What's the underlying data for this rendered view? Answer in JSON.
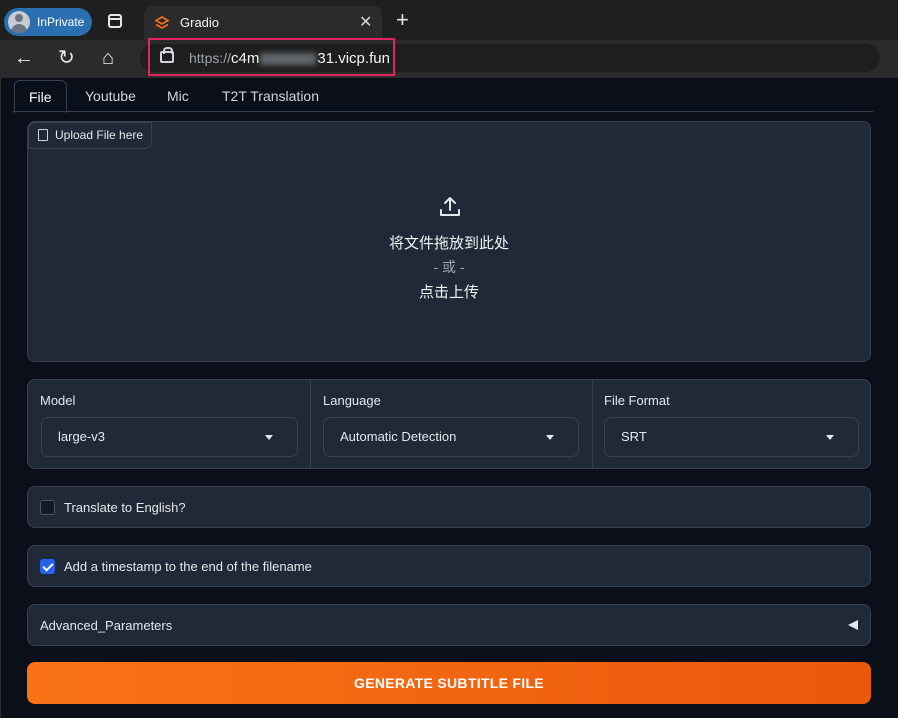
{
  "browser": {
    "profile_label": "InPrivate",
    "tab_title": "Gradio",
    "tab_close": "✕",
    "new_tab": "+",
    "url_scheme": "https://",
    "url_host_start": "c4m",
    "url_host_end": "31.vicp.fun",
    "nav": {
      "back": "←",
      "refresh": "↻",
      "home": "⌂"
    }
  },
  "tabs": [
    {
      "label": "File",
      "selected": true
    },
    {
      "label": "Youtube",
      "selected": false
    },
    {
      "label": "Mic",
      "selected": false
    },
    {
      "label": "T2T Translation",
      "selected": false
    }
  ],
  "upload": {
    "chip_label": "Upload File here",
    "drop_text": "将文件拖放到此处",
    "or_text": "- 或 -",
    "click_text": "点击上传"
  },
  "options": {
    "model": {
      "label": "Model",
      "value": "large-v3"
    },
    "language": {
      "label": "Language",
      "value": "Automatic Detection"
    },
    "file_format": {
      "label": "File Format",
      "value": "SRT"
    }
  },
  "translate_checkbox": {
    "label": "Translate to English?",
    "checked": false
  },
  "timestamp_checkbox": {
    "label": "Add a timestamp to the end of the filename",
    "checked": true
  },
  "advanced": {
    "label": "Advanced_Parameters"
  },
  "generate_button": {
    "label": "GENERATE SUBTITLE FILE"
  },
  "colors": {
    "accent": "#f97316",
    "checkbox": "#2563eb",
    "highlight": "#e0245e",
    "profile": "#2a6fb0"
  }
}
